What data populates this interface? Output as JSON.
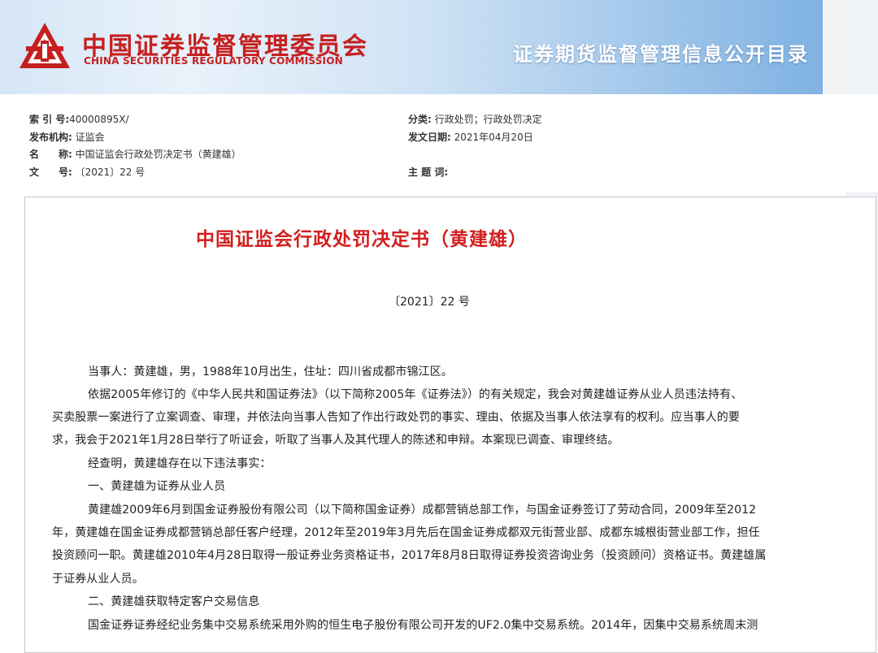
{
  "header": {
    "org_cn": "中国证券监督管理委员会",
    "org_en": "CHINA SECURITIES REGULATORY COMMISSION",
    "catalog_title": "证券期货监督管理信息公开目录",
    "brand_color": "#c61f1f"
  },
  "meta": {
    "index_label": "索 引 号:",
    "index_value": "40000895X/",
    "category_label": "分类:",
    "category_value": " 行政处罚；行政处罚决定",
    "issuer_label": "发布机构:",
    "issuer_value": " 证监会",
    "date_label": "发文日期:",
    "date_value": " 2021年04月20日",
    "name_label": "名　　称:",
    "name_value": " 中国证监会行政处罚决定书（黄建雄）",
    "docno_label": "文　　号:",
    "docno_value": " 〔2021〕22 号",
    "keywords_label": "主 题 词:"
  },
  "document": {
    "title": "中国证监会行政处罚决定书（黄建雄）",
    "number": "〔2021〕22 号",
    "title_color": "#d12020",
    "lines": [
      "当事人：黄建雄，男，1988年10月出生，住址：四川省成都市锦江区。",
      "依据2005年修订的《中华人民共和国证券法》（以下简称2005年《证券法》）的有关规定，我会对黄建雄证券从业人员违法持有、",
      "买卖股票一案进行了立案调查、审理，并依法向当事人告知了作出行政处罚的事实、理由、依据及当事人依法享有的权利。应当事人的要",
      "求，我会于2021年1月28日举行了听证会，听取了当事人及其代理人的陈述和申辩。本案现已调查、审理终结。",
      "经查明，黄建雄存在以下违法事实：",
      "一、黄建雄为证券从业人员",
      "黄建雄2009年6月到国金证券股份有限公司（以下简称国金证券）成都营销总部工作，与国金证券签订了劳动合同，2009年至2012",
      "年，黄建雄在国金证券成都营销总部任客户经理，2012年至2019年3月先后在国金证券成都双元街营业部、成都东城根街营业部工作，担任",
      "投资顾问一职。黄建雄2010年4月28日取得一般证券业务资格证书，2017年8月8日取得证券投资咨询业务（投资顾问）资格证书。黄建雄属",
      "于证券从业人员。",
      "二、黄建雄获取特定客户交易信息",
      "国金证券证券经纪业务集中交易系统采用外购的恒生电子股份有限公司开发的UF2.0集中交易系统。2014年，因集中交易系统周末测"
    ]
  }
}
